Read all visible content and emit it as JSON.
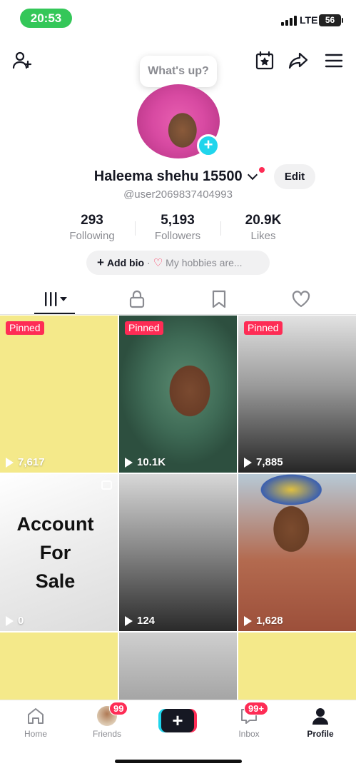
{
  "status_bar": {
    "time": "20:53",
    "network": "LTE",
    "battery": "56"
  },
  "top_bar": {
    "prompt_bubble": "What's up?"
  },
  "profile": {
    "display_name": "Haleema shehu 15500",
    "username": "@user2069837404993",
    "edit_label": "Edit",
    "stats": [
      {
        "value": "293",
        "label": "Following"
      },
      {
        "value": "5,193",
        "label": "Followers"
      },
      {
        "value": "20.9K",
        "label": "Likes"
      }
    ],
    "bio": {
      "add_label": "Add bio",
      "separator": "·",
      "hobbies": "My hobbies are..."
    }
  },
  "tabs": [
    "videos-grid",
    "private",
    "saved",
    "liked"
  ],
  "grid": [
    {
      "pinned": "Pinned",
      "views": "7,617",
      "bg": "#f4e98a"
    },
    {
      "pinned": "Pinned",
      "views": "10.1K",
      "bg": "photo"
    },
    {
      "pinned": "Pinned",
      "views": "7,885",
      "bg": "gradient"
    },
    {
      "views": "0",
      "text": [
        "Account",
        "For",
        "Sale"
      ],
      "bg": "#f2f2f2"
    },
    {
      "views": "124",
      "bg": "gradient"
    },
    {
      "views": "1,628",
      "bg": "photo"
    },
    {
      "bg": "#f4e98a"
    },
    {
      "bg": "gradient"
    },
    {
      "bg": "#f4e98a"
    }
  ],
  "bottom_nav": [
    {
      "label": "Home"
    },
    {
      "label": "Friends",
      "badge": "99"
    },
    {
      "label": ""
    },
    {
      "label": "Inbox",
      "badge": "99+"
    },
    {
      "label": "Profile"
    }
  ],
  "colors": {
    "accent": "#fe2c55",
    "cyan": "#20d5ec",
    "pinned_yellow": "#f4e98a"
  }
}
